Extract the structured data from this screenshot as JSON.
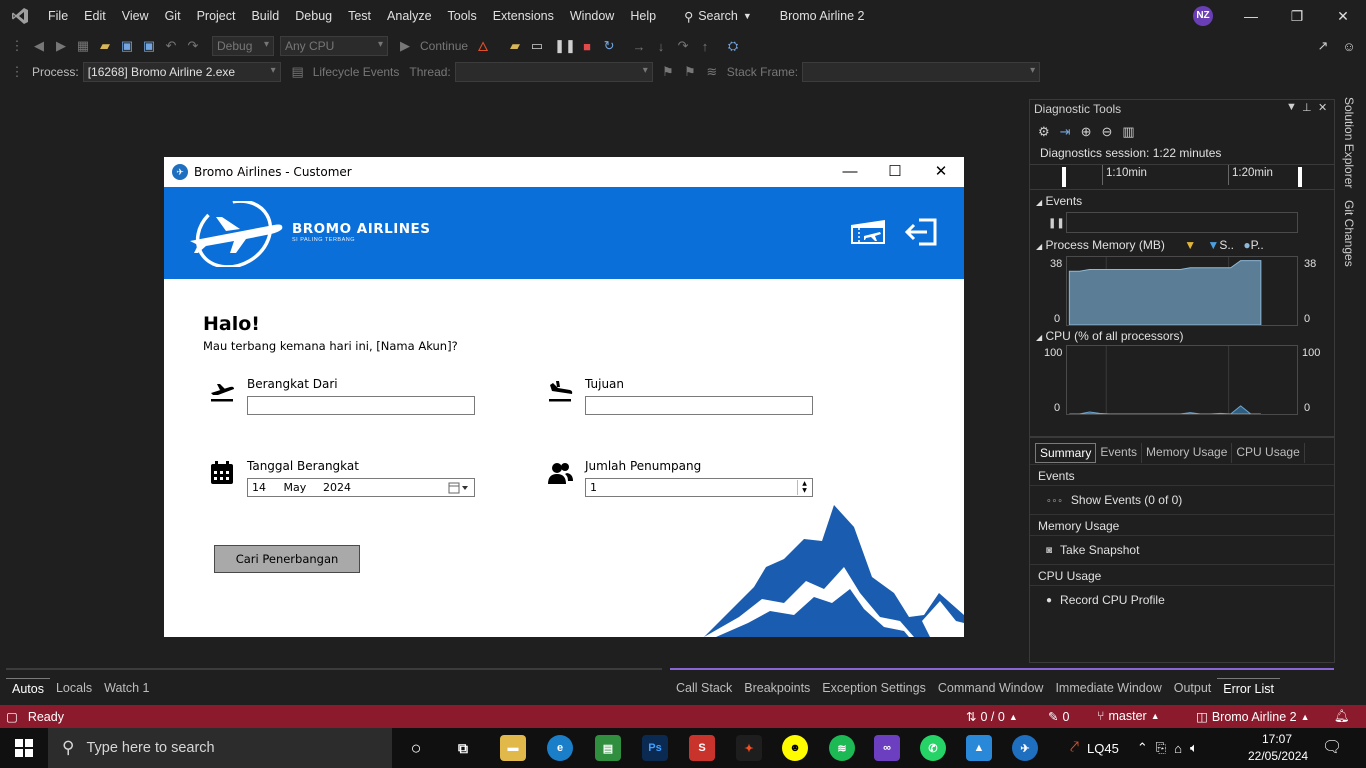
{
  "menu": {
    "items": [
      "File",
      "Edit",
      "View",
      "Git",
      "Project",
      "Build",
      "Debug",
      "Test",
      "Analyze",
      "Tools",
      "Extensions",
      "Window",
      "Help"
    ],
    "search_label": "Search",
    "solution_name": "Bromo Airline 2",
    "user_initials": "NZ"
  },
  "toolbar": {
    "config": "Debug",
    "platform": "Any CPU",
    "continue_label": "Continue",
    "process_label": "Process:",
    "process_value": "[16268] Bromo Airline 2.exe",
    "lifecycle_label": "Lifecycle Events",
    "thread_label": "Thread:",
    "stack_frame_label": "Stack Frame:"
  },
  "form": {
    "title": "Bromo Airlines -  Customer",
    "brand_name": "BROMO AIRLINES",
    "brand_tagline": "SI PALING TERBANG",
    "greeting": "Halo!",
    "subgreeting": "Mau terbang kemana hari ini, [Nama Akun]?",
    "from_label": "Berangkat Dari",
    "to_label": "Tujuan",
    "date_label": "Tanggal Berangkat",
    "date_day": "14",
    "date_month": "May",
    "date_year": "2024",
    "passengers_label": "Jumlah Penumpang",
    "passengers_value": "1",
    "search_button": "Cari Penerbangan",
    "colors": {
      "header": "#0a6fd8",
      "mountain": "#1a5cb0"
    }
  },
  "diagnostics": {
    "title": "Diagnostic Tools",
    "session": "Diagnostics session: 1:22 minutes",
    "ticks": [
      "1:10min",
      "1:20min"
    ],
    "events_title": "Events",
    "memory_title": "Process Memory (MB)",
    "memory_legend": [
      "S..",
      "P.."
    ],
    "memory_max": "38",
    "memory_min": "0",
    "cpu_title": "CPU (% of all processors)",
    "cpu_max": "100",
    "cpu_min": "0",
    "tabs": [
      "Summary",
      "Events",
      "Memory Usage",
      "CPU Usage"
    ],
    "sections": {
      "events": "Events",
      "show_events": "Show Events (0 of 0)",
      "memory": "Memory Usage",
      "snapshot": "Take Snapshot",
      "cpu": "CPU Usage",
      "record_cpu": "Record CPU Profile"
    },
    "memory_series_mb": [
      30,
      30,
      31,
      31,
      31,
      31,
      31,
      31,
      31,
      31,
      31,
      31,
      32,
      32,
      32,
      32,
      32,
      36,
      36,
      36
    ],
    "cpu_series_pct": [
      0,
      0,
      3,
      1,
      0,
      0,
      0,
      0,
      0,
      0,
      0,
      0,
      2,
      0,
      0,
      1,
      0,
      12,
      0,
      0
    ]
  },
  "side_tabs": [
    "Solution Explorer",
    "Git Changes"
  ],
  "bottom": {
    "autos_tabs": [
      "Autos",
      "Locals",
      "Watch 1"
    ],
    "debug_tabs": [
      "Call Stack",
      "Breakpoints",
      "Exception Settings",
      "Command Window",
      "Immediate Window",
      "Output",
      "Error List"
    ]
  },
  "status": {
    "ready": "Ready",
    "updown": "0 / 0",
    "pencil": "0",
    "branch": "master",
    "project": "Bromo Airline 2"
  },
  "taskbar": {
    "search_placeholder": "Type here to search",
    "stock": "LQ45",
    "time": "17:07",
    "date": "22/05/2024"
  }
}
